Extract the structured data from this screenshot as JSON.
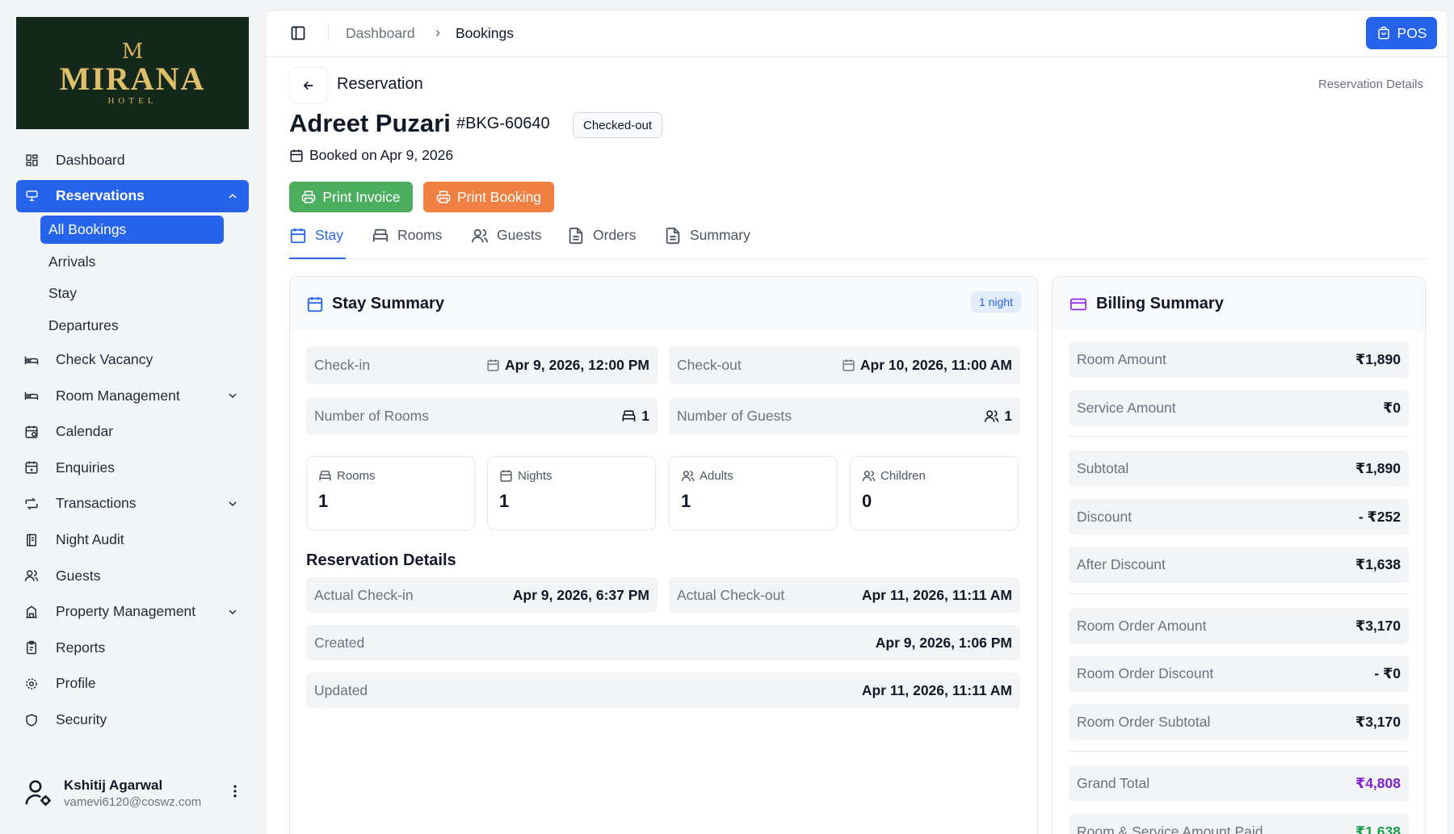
{
  "logo": {
    "letter": "M",
    "name": "MIRANA",
    "sub": "HOTEL"
  },
  "sidebar": {
    "items": [
      {
        "label": "Dashboard"
      },
      {
        "label": "Reservations"
      },
      {
        "label": "Check Vacancy"
      },
      {
        "label": "Room Management"
      },
      {
        "label": "Calendar"
      },
      {
        "label": "Enquiries"
      },
      {
        "label": "Transactions"
      },
      {
        "label": "Night Audit"
      },
      {
        "label": "Guests"
      },
      {
        "label": "Property Management"
      },
      {
        "label": "Reports"
      },
      {
        "label": "Profile"
      },
      {
        "label": "Security"
      }
    ],
    "sub_items": [
      {
        "label": "All Bookings"
      },
      {
        "label": "Arrivals"
      },
      {
        "label": "Stay"
      },
      {
        "label": "Departures"
      }
    ]
  },
  "user": {
    "name": "Kshitij Agarwal",
    "email": "vamevi6120@coswz.com"
  },
  "header": {
    "breadcrumb": [
      "Dashboard",
      "Bookings"
    ],
    "pos_label": "POS"
  },
  "page": {
    "label": "Reservation",
    "right_label": "Reservation Details"
  },
  "guest": {
    "name": "Adreet Puzari",
    "booking_id": "#BKG-60640",
    "status": "Checked-out",
    "booked_on": "Booked on Apr 9, 2026"
  },
  "actions": {
    "print_invoice": "Print Invoice",
    "print_booking": "Print Booking"
  },
  "tabs": [
    {
      "label": "Stay"
    },
    {
      "label": "Rooms"
    },
    {
      "label": "Guests"
    },
    {
      "label": "Orders"
    },
    {
      "label": "Summary"
    }
  ],
  "stay": {
    "title": "Stay Summary",
    "nights_badge": "1 night",
    "checkin_label": "Check-in",
    "checkin_value": "Apr 9, 2026, 12:00 PM",
    "checkout_label": "Check-out",
    "checkout_value": "Apr 10, 2026, 11:00 AM",
    "rooms_label": "Number of Rooms",
    "rooms_value": "1",
    "guests_label": "Number of Guests",
    "guests_value": "1",
    "cards": [
      {
        "label": "Rooms",
        "value": "1"
      },
      {
        "label": "Nights",
        "value": "1"
      },
      {
        "label": "Adults",
        "value": "1"
      },
      {
        "label": "Children",
        "value": "0"
      }
    ],
    "details_title": "Reservation Details",
    "actual_checkin_label": "Actual Check-in",
    "actual_checkin_value": "Apr 9, 2026, 6:37 PM",
    "actual_checkout_label": "Actual Check-out",
    "actual_checkout_value": "Apr 11, 2026, 11:11 AM",
    "created_label": "Created",
    "created_value": "Apr 9, 2026, 1:06 PM",
    "updated_label": "Updated",
    "updated_value": "Apr 11, 2026, 11:11 AM"
  },
  "billing": {
    "title": "Billing Summary",
    "rows": [
      {
        "label": "Room Amount",
        "value": "₹1,890"
      },
      {
        "label": "Service Amount",
        "value": "₹0"
      },
      {
        "label": "Subtotal",
        "value": "₹1,890"
      },
      {
        "label": "Discount",
        "value": "- ₹252"
      },
      {
        "label": "After Discount",
        "value": "₹1,638"
      },
      {
        "label": "Room Order Amount",
        "value": "₹3,170"
      },
      {
        "label": "Room Order Discount",
        "value": "- ₹0"
      },
      {
        "label": "Room Order Subtotal",
        "value": "₹3,170"
      },
      {
        "label": "Grand Total",
        "value": "₹4,808"
      },
      {
        "label": "Room & Service Amount Paid",
        "value": "₹1,638"
      }
    ]
  },
  "colors": {
    "accent": "#2563eb",
    "invoice_btn": "#4caf60",
    "booking_btn": "#f07f42",
    "grand_total": "#7e22ce",
    "paid": "#16a34a",
    "billing_icon": "#9333ea"
  }
}
